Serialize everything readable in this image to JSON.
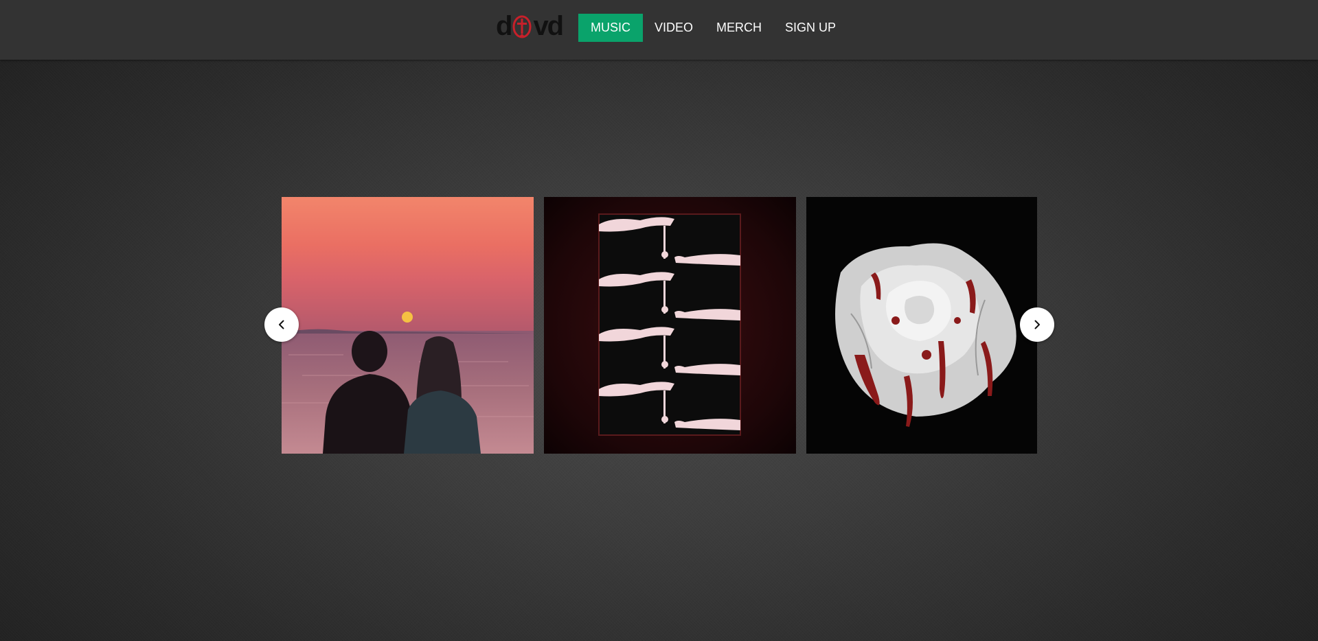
{
  "brand": {
    "logo_text_left": "d",
    "logo_text_right": "vd",
    "accent_color": "#0aa36b"
  },
  "nav": {
    "items": [
      {
        "label": "MUSIC",
        "active": true
      },
      {
        "label": "VIDEO",
        "active": false
      },
      {
        "label": "MERCH",
        "active": false
      },
      {
        "label": "SIGN UP",
        "active": false
      }
    ]
  },
  "carousel": {
    "slides": [
      {
        "image": "sunset-couple-image"
      },
      {
        "image": "hands-rose-pattern-image"
      },
      {
        "image": "bloody-white-rose-image"
      }
    ],
    "prev_icon": "chevron-left-icon",
    "next_icon": "chevron-right-icon"
  }
}
